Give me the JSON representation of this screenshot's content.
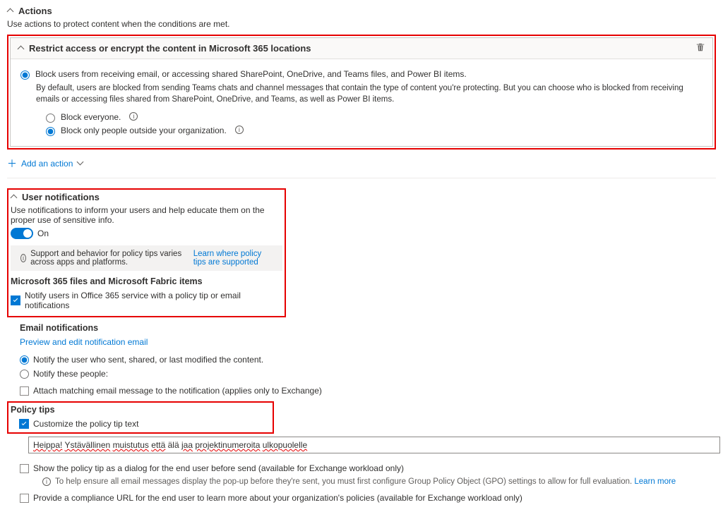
{
  "actions": {
    "title": "Actions",
    "subtitle": "Use actions to protect content when the conditions are met.",
    "addAction": "Add an action",
    "card": {
      "title": "Restrict access or encrypt the content in Microsoft 365 locations",
      "radio1Label": "Block users from receiving email, or accessing shared SharePoint, OneDrive, and Teams files, and Power BI items.",
      "radio1Desc": "By default, users are blocked from sending Teams chats and channel messages that contain the type of content you're protecting. But you can choose who is blocked from receiving emails or accessing files shared from SharePoint, OneDrive, and Teams, as well as Power BI items.",
      "subRadio1": "Block everyone.",
      "subRadio2": "Block only people outside your organization."
    }
  },
  "userNotifications": {
    "title": "User notifications",
    "subtitle": "Use notifications to inform your users and help educate them on the proper use of sensitive info.",
    "toggleLabel": "On",
    "infoBarText": "Support and behavior for policy tips varies across apps and platforms.",
    "infoBarLink": "Learn where policy tips are supported",
    "m365Header": "Microsoft 365 files and Microsoft Fabric items",
    "notifyCheckbox": "Notify users in Office 365 service with a policy tip or email notifications"
  },
  "emailNotifications": {
    "title": "Email notifications",
    "previewLink": "Preview and edit notification email",
    "radio1": "Notify the user who sent, shared, or last modified the content.",
    "radio2": "Notify these people:",
    "attach": "Attach matching email message to the notification (applies only to Exchange)"
  },
  "policyTips": {
    "title": "Policy tips",
    "customizeLabel": "Customize the policy tip text",
    "tipTextWords": [
      "Heippa!",
      "Ystävällinen",
      "muistutus",
      "että",
      "älä",
      "jaa",
      "projektinumeroita",
      "ulkopuolelle"
    ],
    "tipTextWavy": [
      true,
      true,
      true,
      true,
      false,
      true,
      true,
      true
    ],
    "showDialog": "Show the policy tip as a dialog for the end user before send (available for Exchange workload only)",
    "helpText": "To help ensure all email messages display the pop-up before they're sent, you must first configure Group Policy Object (GPO) settings to allow for full evaluation.",
    "helpLink": "Learn more",
    "complianceUrl": "Provide a compliance URL for the end user to learn more about your organization's policies (available for Exchange workload only)"
  }
}
